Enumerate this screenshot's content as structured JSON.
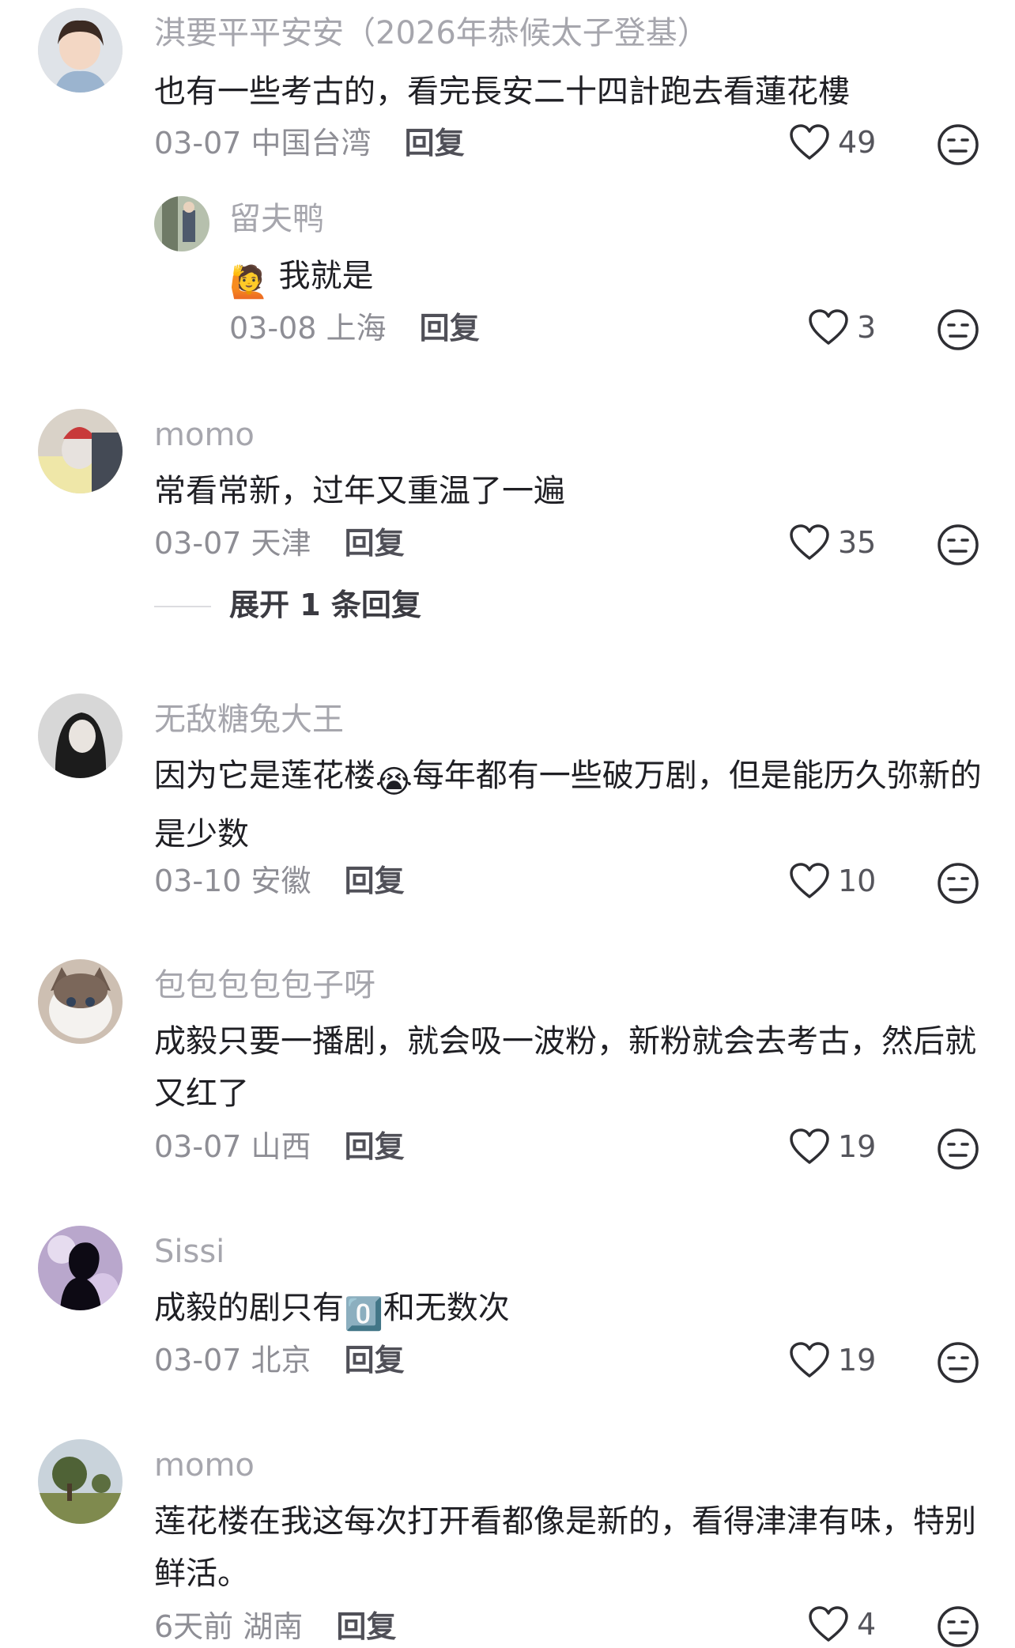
{
  "comments": [
    {
      "username": "淇要平平安安（2026年恭候太子登基）",
      "text": "也有一些考古的，看完長安二十四計跑去看蓮花樓",
      "date": "03-07",
      "location": "中国台湾",
      "reply_label": "回复",
      "likes": "49",
      "reply": {
        "username": "留夫鸭",
        "emoji": "🙋",
        "text": "我就是",
        "date": "03-08",
        "location": "上海",
        "reply_label": "回复",
        "likes": "3"
      }
    },
    {
      "username": "momo",
      "text": "常看常新，过年又重温了一遍",
      "date": "03-07",
      "location": "天津",
      "reply_label": "回复",
      "likes": "35",
      "expand_label": "展开 1 条回复"
    },
    {
      "username": "无敌糖兔大王",
      "text_before": "因为它是莲花楼",
      "emoji": "😭",
      "text_after": "每年都有一些破万剧，但是能历久弥新的是少数",
      "date": "03-10",
      "location": "安徽",
      "reply_label": "回复",
      "likes": "10"
    },
    {
      "username": "包包包包包子呀",
      "text": "成毅只要一播剧，就会吸一波粉，新粉就会去考古，然后就又红了",
      "date": "03-07",
      "location": "山西",
      "reply_label": "回复",
      "likes": "19"
    },
    {
      "username": "Sissi",
      "text_before": "成毅的剧只有",
      "emoji": "0️⃣",
      "text_after": "和无数次",
      "date": "03-07",
      "location": "北京",
      "reply_label": "回复",
      "likes": "19"
    },
    {
      "username": "momo",
      "text": "莲花楼在我这每次打开看都像是新的，看得津津有味，特别鲜活。",
      "date": "6天前",
      "location": "湖南",
      "reply_label": "回复",
      "likes": "4"
    }
  ],
  "icons": {
    "like": "heart-outline-icon",
    "dislike": "meh-face-icon"
  },
  "colors": {
    "username": "#a6a6ad",
    "text": "#1f1f24",
    "meta": "#8e8e95"
  }
}
